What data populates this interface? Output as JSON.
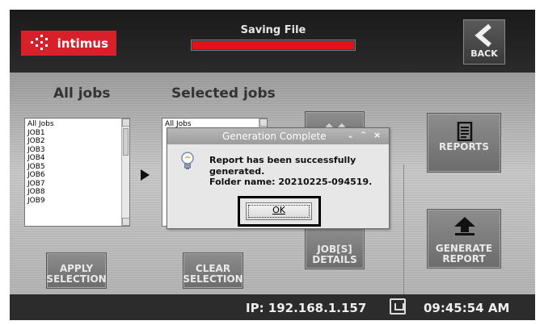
{
  "header": {
    "logo_text": "intimus",
    "status_title": "Saving File",
    "progress": 1.0,
    "back_label": "BACK"
  },
  "lists": {
    "all_title": "All jobs",
    "selected_title": "Selected jobs",
    "all_items": [
      "All Jobs",
      "JOB1",
      "JOB2",
      "JOB3",
      "JOB4",
      "JOB5",
      "JOB6",
      "JOB7",
      "JOB8",
      "JOB9"
    ],
    "selected_items": [
      "All Jobs"
    ]
  },
  "buttons": {
    "apply_line1": "APPLY",
    "apply_line2": "SELECTION",
    "clear_line1": "CLEAR",
    "clear_line2": "SELECTION",
    "jobs_line1": "JOB[S]",
    "jobs_line2": "DETAILS",
    "reports": "REPORTS",
    "generate_line1": "GENERATE",
    "generate_line2": "REPORT"
  },
  "footer": {
    "ip": "IP: 192.168.1.157",
    "time": "09:45:54 AM"
  },
  "dialog": {
    "title": "Generation Complete",
    "line1": "Report has been successfully",
    "line2": "generated.",
    "line3": "Folder name: 20210225-094519.",
    "ok_label": "OK"
  },
  "colors": {
    "brand": "#d8202a",
    "progress": "#e0141e"
  }
}
